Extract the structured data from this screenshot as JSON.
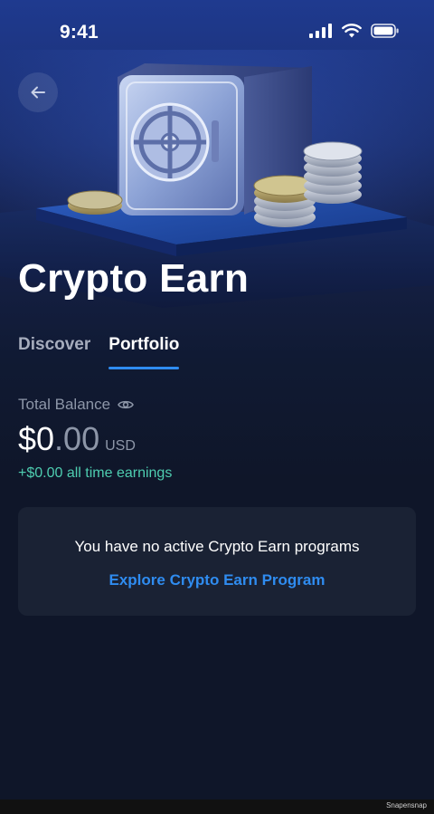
{
  "status_bar": {
    "time": "9:41",
    "icons": [
      "signal-icon",
      "wifi-icon",
      "battery-icon"
    ]
  },
  "header": {
    "back_icon": "back-arrow-icon",
    "title": "Crypto Earn"
  },
  "tabs": [
    {
      "label": "Discover",
      "active": false
    },
    {
      "label": "Portfolio",
      "active": true
    }
  ],
  "balance": {
    "label": "Total Balance",
    "visibility_icon": "eye-icon",
    "amount_int": "$0",
    "amount_dec": ".00",
    "currency": "USD",
    "earnings": "+$0.00 all time earnings"
  },
  "empty_state": {
    "message": "You have no active Crypto Earn programs",
    "link_label": "Explore Crypto Earn Program"
  },
  "watermark": "Snapensnap",
  "colors": {
    "accent": "#2f8cf0",
    "earnings": "#4ecdb0",
    "background": "#0f1629",
    "card": "#1a2234"
  }
}
